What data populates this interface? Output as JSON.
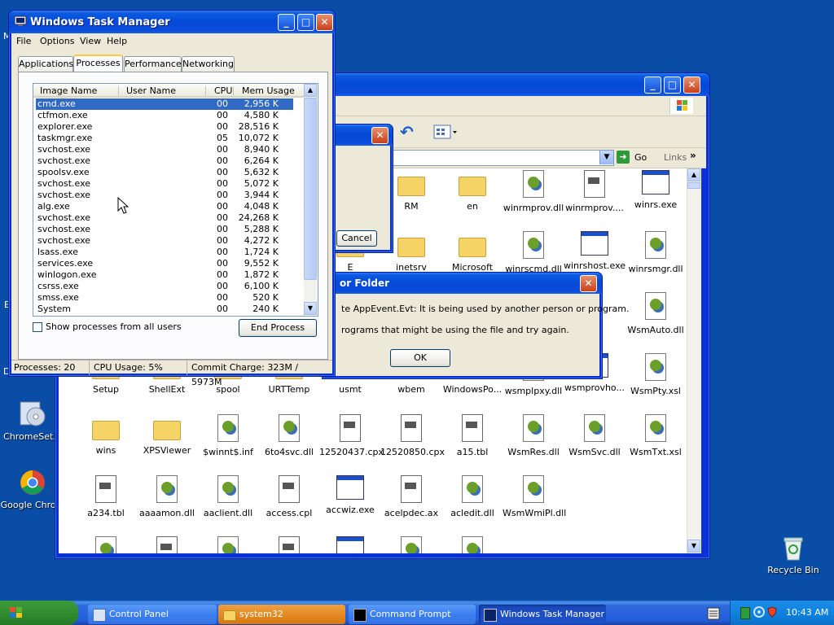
{
  "desktop": {
    "icons": [
      {
        "label": "ChromeSet...",
        "icon": "cd-setup-icon"
      },
      {
        "label": "Google Chrom",
        "icon": "chrome-icon"
      },
      {
        "label": "Recycle Bin",
        "icon": "recycle-bin-icon"
      }
    ],
    "partial_letters": [
      "M",
      "E",
      "D"
    ]
  },
  "explorer": {
    "toolbar": {
      "go_label": "Go",
      "links_label": "Links"
    },
    "items": [
      {
        "label": "RM",
        "type": "folder"
      },
      {
        "label": "en",
        "type": "folder"
      },
      {
        "label": "winrmprov.dll",
        "type": "dll"
      },
      {
        "label": "winrmprov....",
        "type": "doc"
      },
      {
        "label": "winrs.exe",
        "type": "exe"
      },
      {
        "label": "E",
        "type": "folder"
      },
      {
        "label": "inetsrv",
        "type": "folder"
      },
      {
        "label": "Microsoft",
        "type": "folder"
      },
      {
        "label": "winrscmd.dll",
        "type": "dll"
      },
      {
        "label": "winrshost.exe",
        "type": "exe"
      },
      {
        "label": "winrsmgr.dll",
        "type": "dll"
      },
      {
        "label": "WsmAuto.dll",
        "type": "dll"
      },
      {
        "label": "Setup",
        "type": "folder"
      },
      {
        "label": "ShellExt",
        "type": "folder"
      },
      {
        "label": "spool",
        "type": "folder"
      },
      {
        "label": "URTTemp",
        "type": "folder"
      },
      {
        "label": "usmt",
        "type": "folder"
      },
      {
        "label": "wbem",
        "type": "folder"
      },
      {
        "label": "WindowsPo...",
        "type": "folder"
      },
      {
        "label": "wsmplpxy.dll",
        "type": "dll"
      },
      {
        "label": "wsmprovho...",
        "type": "exe"
      },
      {
        "label": "WsmPty.xsl",
        "type": "xsl"
      },
      {
        "label": "wins",
        "type": "folder"
      },
      {
        "label": "XPSViewer",
        "type": "folder"
      },
      {
        "label": "$winnt$.inf",
        "type": "inf"
      },
      {
        "label": "6to4svc.dll",
        "type": "dll"
      },
      {
        "label": "12520437.cpx",
        "type": "doc"
      },
      {
        "label": "12520850.cpx",
        "type": "doc"
      },
      {
        "label": "a15.tbl",
        "type": "doc"
      },
      {
        "label": "WsmRes.dll",
        "type": "dll"
      },
      {
        "label": "WsmSvc.dll",
        "type": "dll"
      },
      {
        "label": "WsmTxt.xsl",
        "type": "xsl"
      },
      {
        "label": "a234.tbl",
        "type": "doc"
      },
      {
        "label": "aaaamon.dll",
        "type": "dll"
      },
      {
        "label": "aaclient.dll",
        "type": "dll"
      },
      {
        "label": "access.cpl",
        "type": "doc"
      },
      {
        "label": "accwiz.exe",
        "type": "exe"
      },
      {
        "label": "acelpdec.ax",
        "type": "doc"
      },
      {
        "label": "acledit.dll",
        "type": "dll"
      },
      {
        "label": "WsmWmiPl.dll",
        "type": "dll"
      }
    ]
  },
  "dialog_small": {
    "cancel_label": "Cancel"
  },
  "error_dialog": {
    "title": "or Folder",
    "line1": "te AppEvent.Evt: It is being used by another person or program.",
    "line2": "rograms that might be using the file and try again.",
    "ok_label": "OK"
  },
  "taskmgr": {
    "title": "Windows Task Manager",
    "menu": [
      "File",
      "Options",
      "View",
      "Help"
    ],
    "tabs": [
      "Applications",
      "Processes",
      "Performance",
      "Networking"
    ],
    "active_tab": "Processes",
    "columns": [
      "Image Name",
      "User Name",
      "CPU",
      "Mem Usage"
    ],
    "processes": [
      {
        "name": "cmd.exe",
        "user": "",
        "cpu": "00",
        "mem": "2,956 K"
      },
      {
        "name": "ctfmon.exe",
        "user": "",
        "cpu": "00",
        "mem": "4,580 K"
      },
      {
        "name": "explorer.exe",
        "user": "",
        "cpu": "00",
        "mem": "28,516 K"
      },
      {
        "name": "taskmgr.exe",
        "user": "",
        "cpu": "05",
        "mem": "10,072 K"
      },
      {
        "name": "svchost.exe",
        "user": "",
        "cpu": "00",
        "mem": "8,940 K"
      },
      {
        "name": "svchost.exe",
        "user": "",
        "cpu": "00",
        "mem": "6,264 K"
      },
      {
        "name": "spoolsv.exe",
        "user": "",
        "cpu": "00",
        "mem": "5,632 K"
      },
      {
        "name": "svchost.exe",
        "user": "",
        "cpu": "00",
        "mem": "5,072 K"
      },
      {
        "name": "svchost.exe",
        "user": "",
        "cpu": "00",
        "mem": "3,944 K"
      },
      {
        "name": "alg.exe",
        "user": "",
        "cpu": "00",
        "mem": "4,048 K"
      },
      {
        "name": "svchost.exe",
        "user": "",
        "cpu": "00",
        "mem": "24,268 K"
      },
      {
        "name": "svchost.exe",
        "user": "",
        "cpu": "00",
        "mem": "5,288 K"
      },
      {
        "name": "svchost.exe",
        "user": "",
        "cpu": "00",
        "mem": "4,272 K"
      },
      {
        "name": "lsass.exe",
        "user": "",
        "cpu": "00",
        "mem": "1,724 K"
      },
      {
        "name": "services.exe",
        "user": "",
        "cpu": "00",
        "mem": "9,552 K"
      },
      {
        "name": "winlogon.exe",
        "user": "",
        "cpu": "00",
        "mem": "1,872 K"
      },
      {
        "name": "csrss.exe",
        "user": "",
        "cpu": "00",
        "mem": "6,100 K"
      },
      {
        "name": "smss.exe",
        "user": "",
        "cpu": "00",
        "mem": "520 K"
      },
      {
        "name": "System",
        "user": "",
        "cpu": "00",
        "mem": "240 K"
      }
    ],
    "selected_index": 0,
    "show_all_label": "Show processes from all users",
    "end_process_label": "End Process",
    "status": {
      "processes": "Processes: 20",
      "cpu": "CPU Usage: 5%",
      "commit": "Commit Charge: 323M / 5973M"
    }
  },
  "taskbar": {
    "buttons": [
      {
        "label": "Control Panel",
        "icon": "control-panel-icon",
        "active": false
      },
      {
        "label": "system32",
        "icon": "folder-icon",
        "active": false
      },
      {
        "label": "Command Prompt",
        "icon": "command-prompt-icon",
        "active": false
      },
      {
        "label": "Windows Task Manager",
        "icon": "task-manager-icon",
        "active": true
      }
    ],
    "clock": "10:43 AM"
  }
}
